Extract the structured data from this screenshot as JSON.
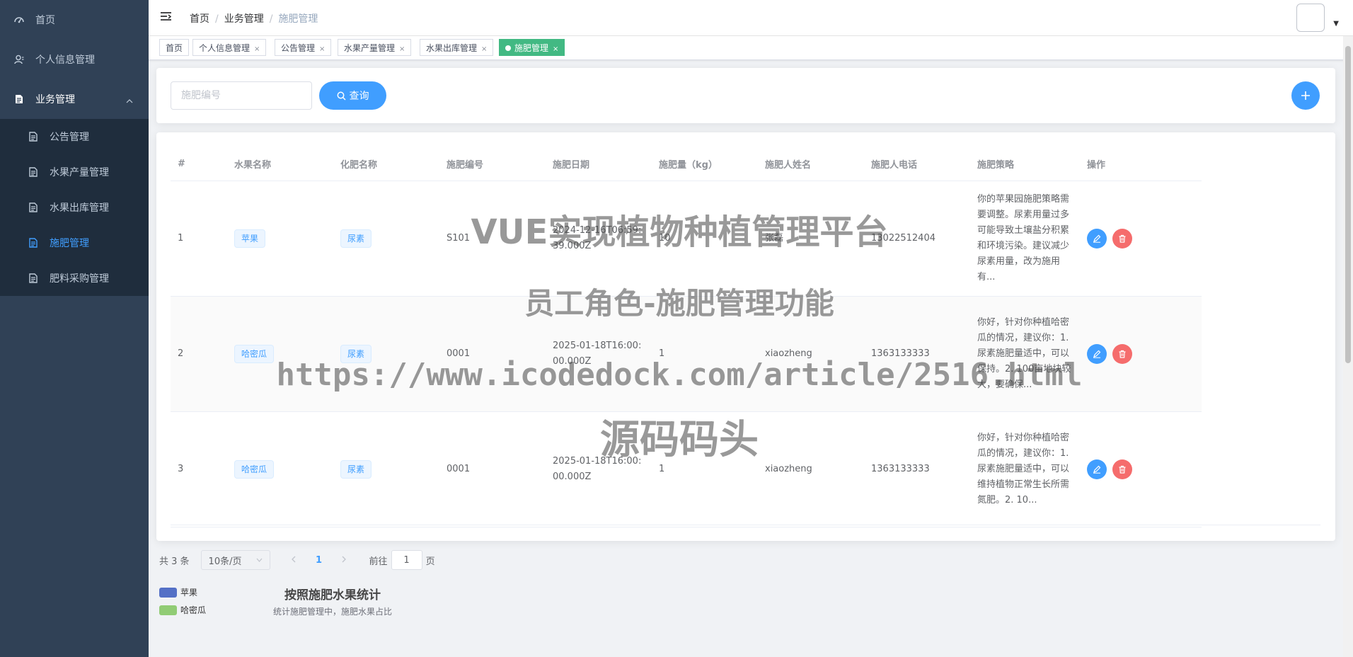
{
  "sidebar": {
    "items": [
      {
        "label": "首页",
        "icon": "dashboard-icon"
      },
      {
        "label": "个人信息管理",
        "icon": "user-icon"
      },
      {
        "label": "业务管理",
        "icon": "document-icon"
      }
    ],
    "submenu": [
      {
        "label": "公告管理",
        "icon": "document-icon"
      },
      {
        "label": "水果产量管理",
        "icon": "document-icon"
      },
      {
        "label": "水果出库管理",
        "icon": "document-icon"
      },
      {
        "label": "施肥管理",
        "icon": "document-icon",
        "active": true
      },
      {
        "label": "肥料采购管理",
        "icon": "document-icon"
      }
    ]
  },
  "breadcrumb": [
    "首页",
    "业务管理",
    "施肥管理"
  ],
  "tags": [
    "首页",
    "个人信息管理",
    "公告管理",
    "水果产量管理",
    "水果出库管理",
    "施肥管理"
  ],
  "tags_close": "×",
  "search": {
    "placeholder": "施肥编号",
    "button": "查询"
  },
  "table": {
    "headers": [
      "#",
      "水果名称",
      "化肥名称",
      "施肥编号",
      "施肥日期",
      "施肥量（kg）",
      "施肥人姓名",
      "施肥人电话",
      "施肥策略",
      "操作"
    ],
    "rows": [
      {
        "index": "1",
        "fruit": "苹果",
        "fertilizer": "尿素",
        "code": "S101",
        "date": "2024-12-16T06:59:39.000Z",
        "amount": "10",
        "person": "张磊",
        "phone": "13022512404",
        "strategy": "你的苹果园施肥策略需要调整。尿素用量过多可能导致土壤盐分积累和环境污染。建议减少尿素用量，改为施用有..."
      },
      {
        "index": "2",
        "fruit": "哈密瓜",
        "fertilizer": "尿素",
        "code": "0001",
        "date": "2025-01-18T16:00:00.000Z",
        "amount": "1",
        "person": "xiaozheng",
        "phone": "1363133333",
        "strategy": "你好，针对你种植哈密瓜的情况，建议你：1. 尿素施肥量适中，可以保持。2. 100亩地块较大，要确保..."
      },
      {
        "index": "3",
        "fruit": "哈密瓜",
        "fertilizer": "尿素",
        "code": "0001",
        "date": "2025-01-18T16:00:00.000Z",
        "amount": "1",
        "person": "xiaozheng",
        "phone": "1363133333",
        "strategy": "你好，针对你种植哈密瓜的情况，建议你：1. 尿素施肥量适中，可以维持植物正常生长所需氮肥。2. 10..."
      }
    ]
  },
  "pagination": {
    "total": "共 3 条",
    "page_size": "10条/页",
    "current": "1",
    "goto_prefix": "前往",
    "goto_value": "1",
    "goto_suffix": "页"
  },
  "chart_data": {
    "type": "pie",
    "title": "按照施肥水果统计",
    "subtitle": "统计施肥管理中，施肥水果占比",
    "legend": [
      {
        "name": "苹果",
        "color": "#5470c6"
      },
      {
        "name": "哈密瓜",
        "color": "#91cc75"
      }
    ],
    "legend_position": "top-left"
  },
  "watermark": {
    "line1": "VUE实现植物种植管理平台",
    "line2": "员工角色-施肥管理功能",
    "line3": "https://www.icodedock.com/article/2516.html",
    "line4": "源码码头"
  },
  "colors": {
    "primary": "#409eff",
    "success": "#42b983",
    "danger": "#f56c6c",
    "sidebar": "#304156"
  }
}
